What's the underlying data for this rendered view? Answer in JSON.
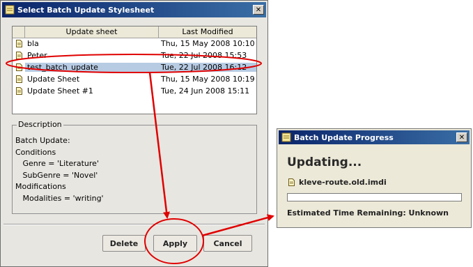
{
  "dialog": {
    "title": "Select Batch Update Stylesheet",
    "close_glyph": "✕",
    "table": {
      "columns": [
        "Update sheet",
        "Last Modified"
      ],
      "rows": [
        {
          "name": "bla",
          "modified": "Thu, 15 May 2008 10:10"
        },
        {
          "name": "Peter",
          "modified": "Tue, 22 Jul 2008 15:53"
        },
        {
          "name": "test_batch_update",
          "modified": "Tue, 22 Jul 2008 16:12"
        },
        {
          "name": "Update Sheet",
          "modified": "Thu, 15 May 2008 10:19"
        },
        {
          "name": "Update Sheet #1",
          "modified": "Tue, 24 Jun 2008 15:11"
        }
      ],
      "selected_index": 2
    },
    "description": {
      "legend": "Description",
      "lines": [
        "Batch Update:",
        "Conditions",
        "   Genre = 'Literature'",
        "   SubGenre = 'Novel'",
        "Modifications",
        "   Modalities = 'writing'"
      ]
    },
    "buttons": {
      "delete": "Delete",
      "apply": "Apply",
      "cancel": "Cancel"
    }
  },
  "progress_dialog": {
    "title": "Batch Update Progress",
    "close_glyph": "✕",
    "heading": "Updating...",
    "file": "kleve-route.old.imdi",
    "progress_fraction": 0.0,
    "eta": "Estimated Time Remaining: Unknown"
  },
  "colors": {
    "title_bar": "#0a246a",
    "selection": "#b7cbe3",
    "annotation": "#e00000"
  }
}
